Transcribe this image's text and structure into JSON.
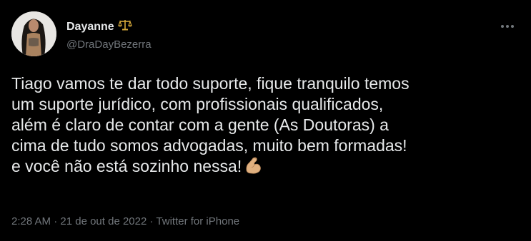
{
  "user": {
    "name": "Dayanne",
    "badge_emoji": "⚖️",
    "handle": "@DraDayBezerra"
  },
  "tweet": {
    "lines": [
      "Tiago vamos te dar todo suporte, fique tranquilo temos",
      "um suporte jurídico, com profissionais qualificados,",
      "além é claro de contar com a gente (As Doutoras) a",
      "cima de tudo somos advogadas, muito bem formadas!",
      "e você não está sozinho nessa!"
    ],
    "trailing_emoji": "flexed-biceps"
  },
  "meta": {
    "time": "2:28 AM",
    "separator": "·",
    "date": "21 de out de 2022",
    "source": "Twitter for iPhone"
  },
  "icons": {
    "more": "more-options-icon",
    "badge": "balance-scale-icon",
    "emoji": "flexed-biceps-icon"
  },
  "colors": {
    "background": "#000000",
    "primary_text": "#e7e9ea",
    "secondary_text": "#71767b"
  }
}
